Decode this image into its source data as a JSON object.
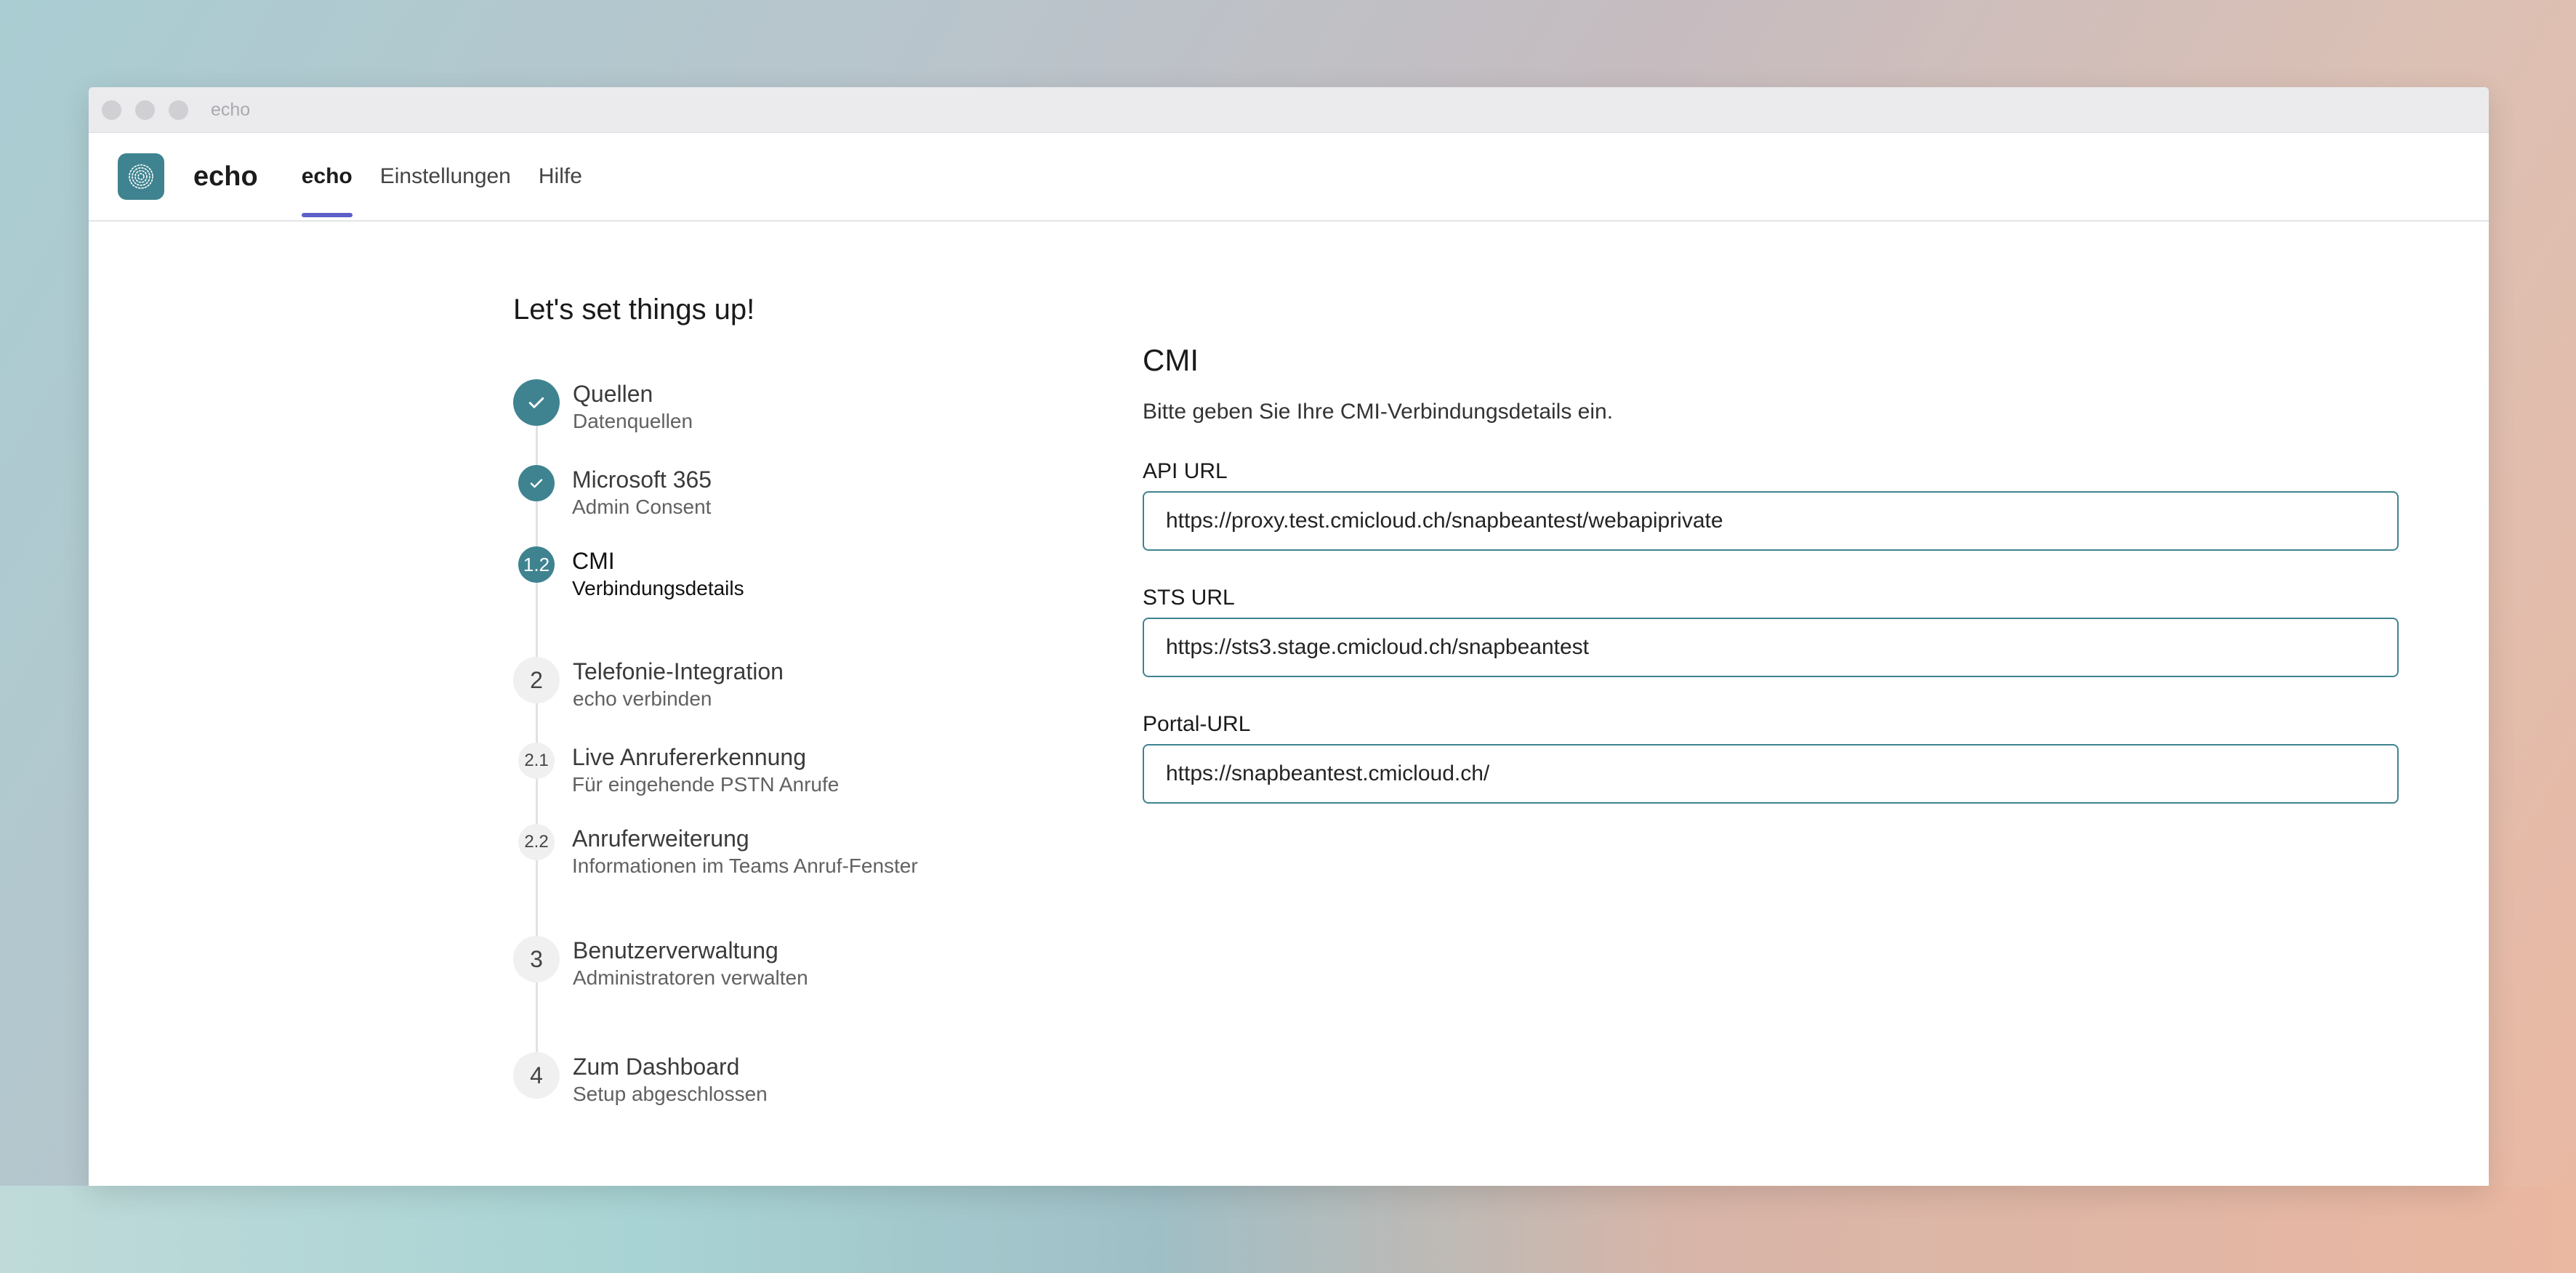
{
  "window": {
    "title": "echo"
  },
  "app": {
    "brand": "echo",
    "nav": [
      {
        "label": "echo",
        "active": true
      },
      {
        "label": "Einstellungen",
        "active": false
      },
      {
        "label": "Hilfe",
        "active": false
      }
    ]
  },
  "main": {
    "heading": "Let's set things up!",
    "steps": [
      {
        "badge": "",
        "state": "done",
        "title": "Quellen",
        "subtitle": "Datenquellen"
      },
      {
        "badge": "",
        "state": "done",
        "title": "Microsoft 365",
        "subtitle": "Admin Consent"
      },
      {
        "badge": "1.2",
        "state": "current",
        "title": "CMI",
        "subtitle": "Verbindungsdetails"
      },
      {
        "badge": "2",
        "state": "pending",
        "title": "Telefonie-Integration",
        "subtitle": "echo verbinden"
      },
      {
        "badge": "2.1",
        "state": "pending",
        "title": "Live Anrufererkennung",
        "subtitle": "Für eingehende PSTN Anrufe"
      },
      {
        "badge": "2.2",
        "state": "pending",
        "title": "Anruferweiterung",
        "subtitle": "Informationen im Teams Anruf-Fenster"
      },
      {
        "badge": "3",
        "state": "pending",
        "title": "Benutzerverwaltung",
        "subtitle": "Administratoren verwalten"
      },
      {
        "badge": "4",
        "state": "pending",
        "title": "Zum Dashboard",
        "subtitle": "Setup abgeschlossen"
      }
    ],
    "panel": {
      "title": "CMI",
      "description": "Bitte geben Sie Ihre CMI-Verbindungsdetails ein.",
      "fields": [
        {
          "label": "API URL",
          "value": "https://proxy.test.cmicloud.ch/snapbeantest/webapiprivate"
        },
        {
          "label": "STS URL",
          "value": "https://sts3.stage.cmicloud.ch/snapbeantest"
        },
        {
          "label": "Portal-URL",
          "value": "https://snapbeantest.cmicloud.ch/"
        }
      ]
    }
  },
  "colors": {
    "accent": "#3f8390",
    "nav_indicator": "#5b5fc7"
  },
  "icons": {
    "check": "check-icon",
    "logo": "fingerprint-logo-icon"
  }
}
